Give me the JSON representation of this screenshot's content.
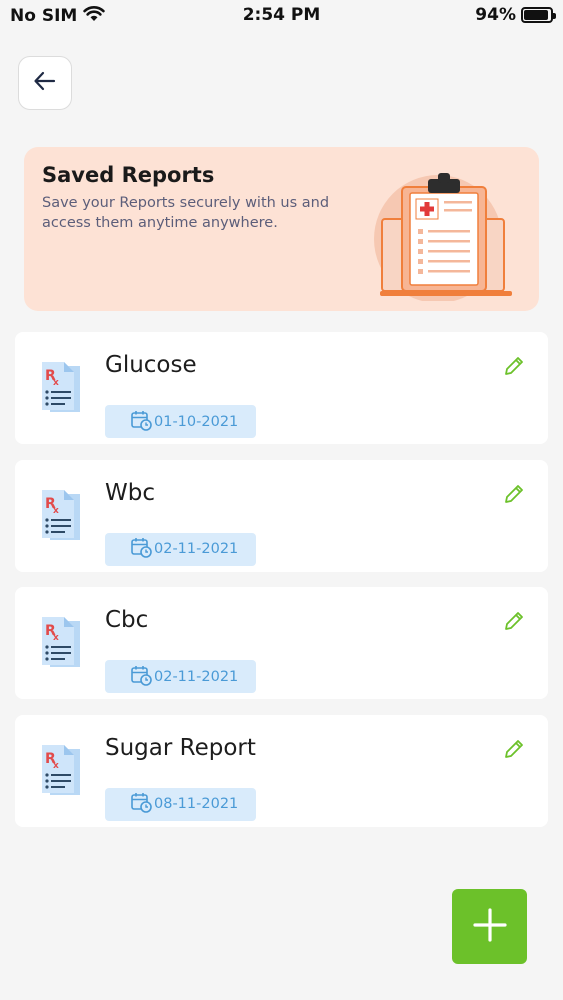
{
  "status_bar": {
    "carrier": "No SIM",
    "time": "2:54 PM",
    "battery": "94%",
    "battery_level": 0.94
  },
  "banner": {
    "title": "Saved Reports",
    "subtitle": "Save your Reports securely with us and access them anytime anywhere."
  },
  "reports": [
    {
      "name": "Glucose",
      "date": "01-10-2021"
    },
    {
      "name": "Wbc",
      "date": "02-11-2021"
    },
    {
      "name": "Cbc",
      "date": "02-11-2021"
    },
    {
      "name": "Sugar Report",
      "date": "08-11-2021"
    }
  ],
  "icons": {
    "back": "arrow-left-icon",
    "edit": "pencil-icon",
    "report": "prescription-document-icon",
    "date": "calendar-clock-icon",
    "add": "plus-icon"
  },
  "colors": {
    "banner_bg": "#fde2d5",
    "chip_bg": "#d9ebfb",
    "chip_text": "#4a9ad6",
    "accent_green": "#6cc12a",
    "edit_green": "#6cc12a"
  }
}
